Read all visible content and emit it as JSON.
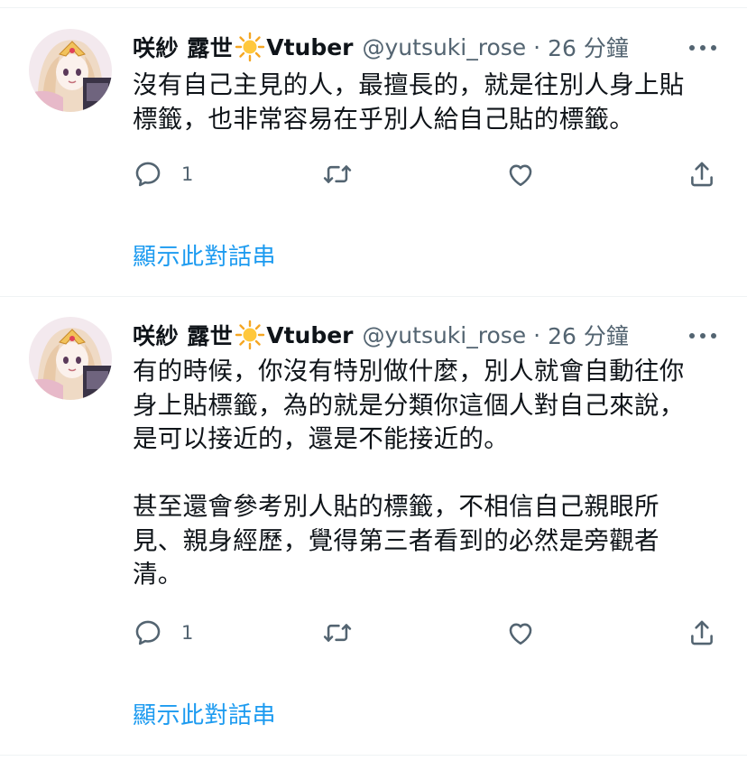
{
  "tweets": [
    {
      "display_name": "咲紗 露世",
      "display_name_emoji": "sun-emoji",
      "display_name_suffix": "Vtuber",
      "handle": "@yutsuki_rose",
      "separator": "·",
      "time": "26 分鐘",
      "text": "沒有自己主見的人，最擅長的，就是往別人身上貼\n標籤，也非常容易在乎別人給自己貼的標籤。",
      "reply_count": "1",
      "thread_link": "顯示此對話串"
    },
    {
      "display_name": "咲紗 露世",
      "display_name_emoji": "sun-emoji",
      "display_name_suffix": "Vtuber",
      "handle": "@yutsuki_rose",
      "separator": "·",
      "time": "26 分鐘",
      "text": "有的時候，你沒有特別做什麼，別人就會自動往你\n身上貼標籤，為的就是分類你這個人對自己來說，\n是可以接近的，還是不能接近的。\n\n甚至還會參考別人貼的標籤，不相信自己親眼所\n見、親身經歷，覺得第三者看到的必然是旁觀者\n清。",
      "reply_count": "1",
      "thread_link": "顯示此對話串"
    }
  ],
  "icons": {
    "reply": "reply-icon",
    "retweet": "retweet-icon",
    "like": "heart-icon",
    "share": "share-icon",
    "more": "more-icon",
    "avatar": "avatar"
  },
  "colors": {
    "text_primary": "#0f1419",
    "text_secondary": "#536471",
    "link": "#1d9bf0",
    "divider": "#eff3f4"
  }
}
